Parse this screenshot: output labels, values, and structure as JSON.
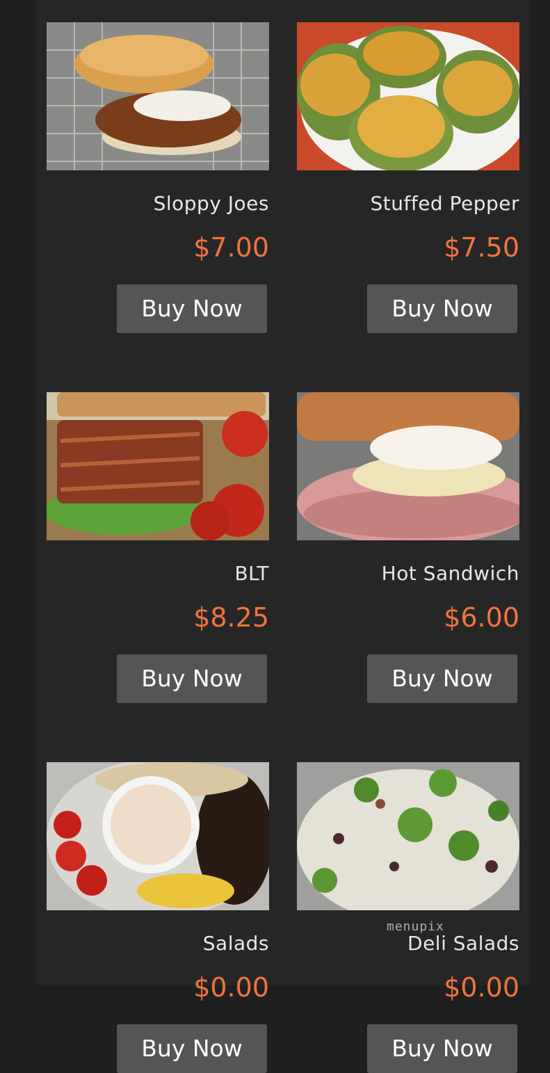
{
  "menu": {
    "items": [
      {
        "name": "Sloppy Joes",
        "price": "$7.00",
        "button": "Buy Now",
        "photo": "sloppy-joes-photo"
      },
      {
        "name": "Stuffed Pepper",
        "price": "$7.50",
        "button": "Buy Now",
        "photo": "stuffed-pepper-photo"
      },
      {
        "name": "BLT",
        "price": "$8.25",
        "button": "Buy Now",
        "photo": "blt-photo"
      },
      {
        "name": "Hot Sandwich",
        "price": "$6.00",
        "button": "Buy Now",
        "photo": "hot-sandwich-photo"
      },
      {
        "name": "Salads",
        "price": "$0.00",
        "button": "Buy Now",
        "photo": "salads-photo"
      },
      {
        "name": "Deli Salads",
        "price": "$0.00",
        "button": "Buy Now",
        "photo": "deli-salads-photo"
      }
    ]
  },
  "watermark": "menupix",
  "colors": {
    "background": "#262626",
    "price": "#f0743e",
    "button": "#555555",
    "text": "#e8e8e8"
  }
}
